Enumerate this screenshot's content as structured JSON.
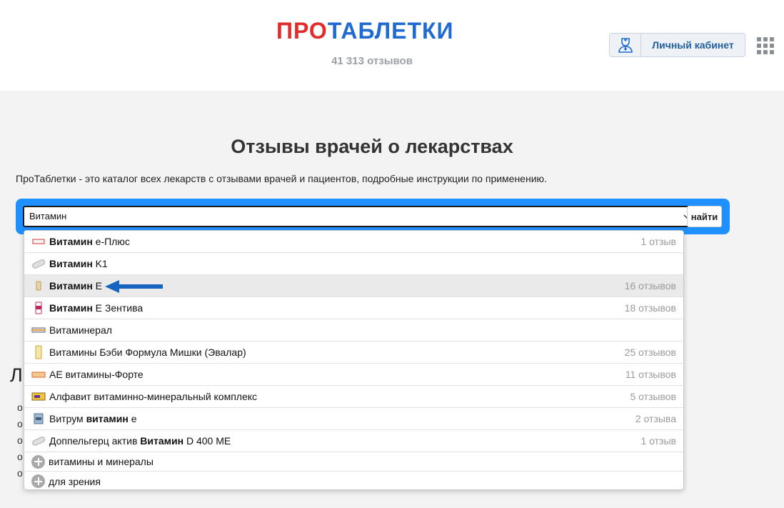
{
  "header": {
    "logo_part1": "ПРО",
    "logo_part2": "ТАБЛЕТКИ",
    "reviews_count": "41 313 отзывов",
    "cabinet_label": "Личный кабинет"
  },
  "main": {
    "title": "Отзывы врачей о лекарствах",
    "intro": "ПроТаблетки - это каталог всех лекарств с отзывами врачей и пациентов, подробные инструкции по применению."
  },
  "search": {
    "value": "Витамин",
    "button_label": "найти"
  },
  "background": {
    "heading_fragment": "Л",
    "line_fragments": [
      "о",
      "о",
      "о",
      "о",
      "о"
    ]
  },
  "dropdown": {
    "items": [
      {
        "bold": "Витамин",
        "rest": " е-Плюс",
        "count": "1 отзыв",
        "icon": "box-thumb"
      },
      {
        "bold": "Витамин",
        "rest": " K1",
        "count": "",
        "icon": "pill-thumb"
      },
      {
        "bold": "Витамин",
        "rest": " Е",
        "count": "16 отзывов",
        "icon": "bottle-thumb"
      },
      {
        "bold": "Витамин",
        "rest": " Е Зентива",
        "count": "18 отзывов",
        "icon": "bottle-red-thumb"
      },
      {
        "pre": "Витаминерал",
        "count": "",
        "icon": "strip-thumb"
      },
      {
        "pre": "Витамины Бэби Формула Мишки (Эвалар)",
        "count": "25 отзывов",
        "icon": "tube-thumb"
      },
      {
        "pre": "АЕ витамины-Форте",
        "count": "11 отзывов",
        "icon": "box-orange-thumb"
      },
      {
        "pre": "Алфавит витаминно-минеральный комплекс",
        "count": "5 отзывов",
        "icon": "box-yellow-thumb"
      },
      {
        "pre": "Витрум ",
        "bold": "витамин",
        "rest": " е",
        "count": "2 отзыва",
        "icon": "box-blue-thumb"
      },
      {
        "pre": "Доппельгерц актив ",
        "bold": "Витамин",
        "rest": " D 400 МЕ",
        "count": "1 отзыв",
        "icon": "pill-thumb"
      }
    ],
    "categories": [
      {
        "label": "витамины и минералы",
        "icon": "plus-icon"
      },
      {
        "label": "для зрения",
        "icon": "plus-icon"
      }
    ]
  },
  "colors": {
    "logo_red": "#e22b2b",
    "logo_blue": "#1f6bd1",
    "search_bg": "#1e90ff",
    "arrow": "#1565c0"
  }
}
